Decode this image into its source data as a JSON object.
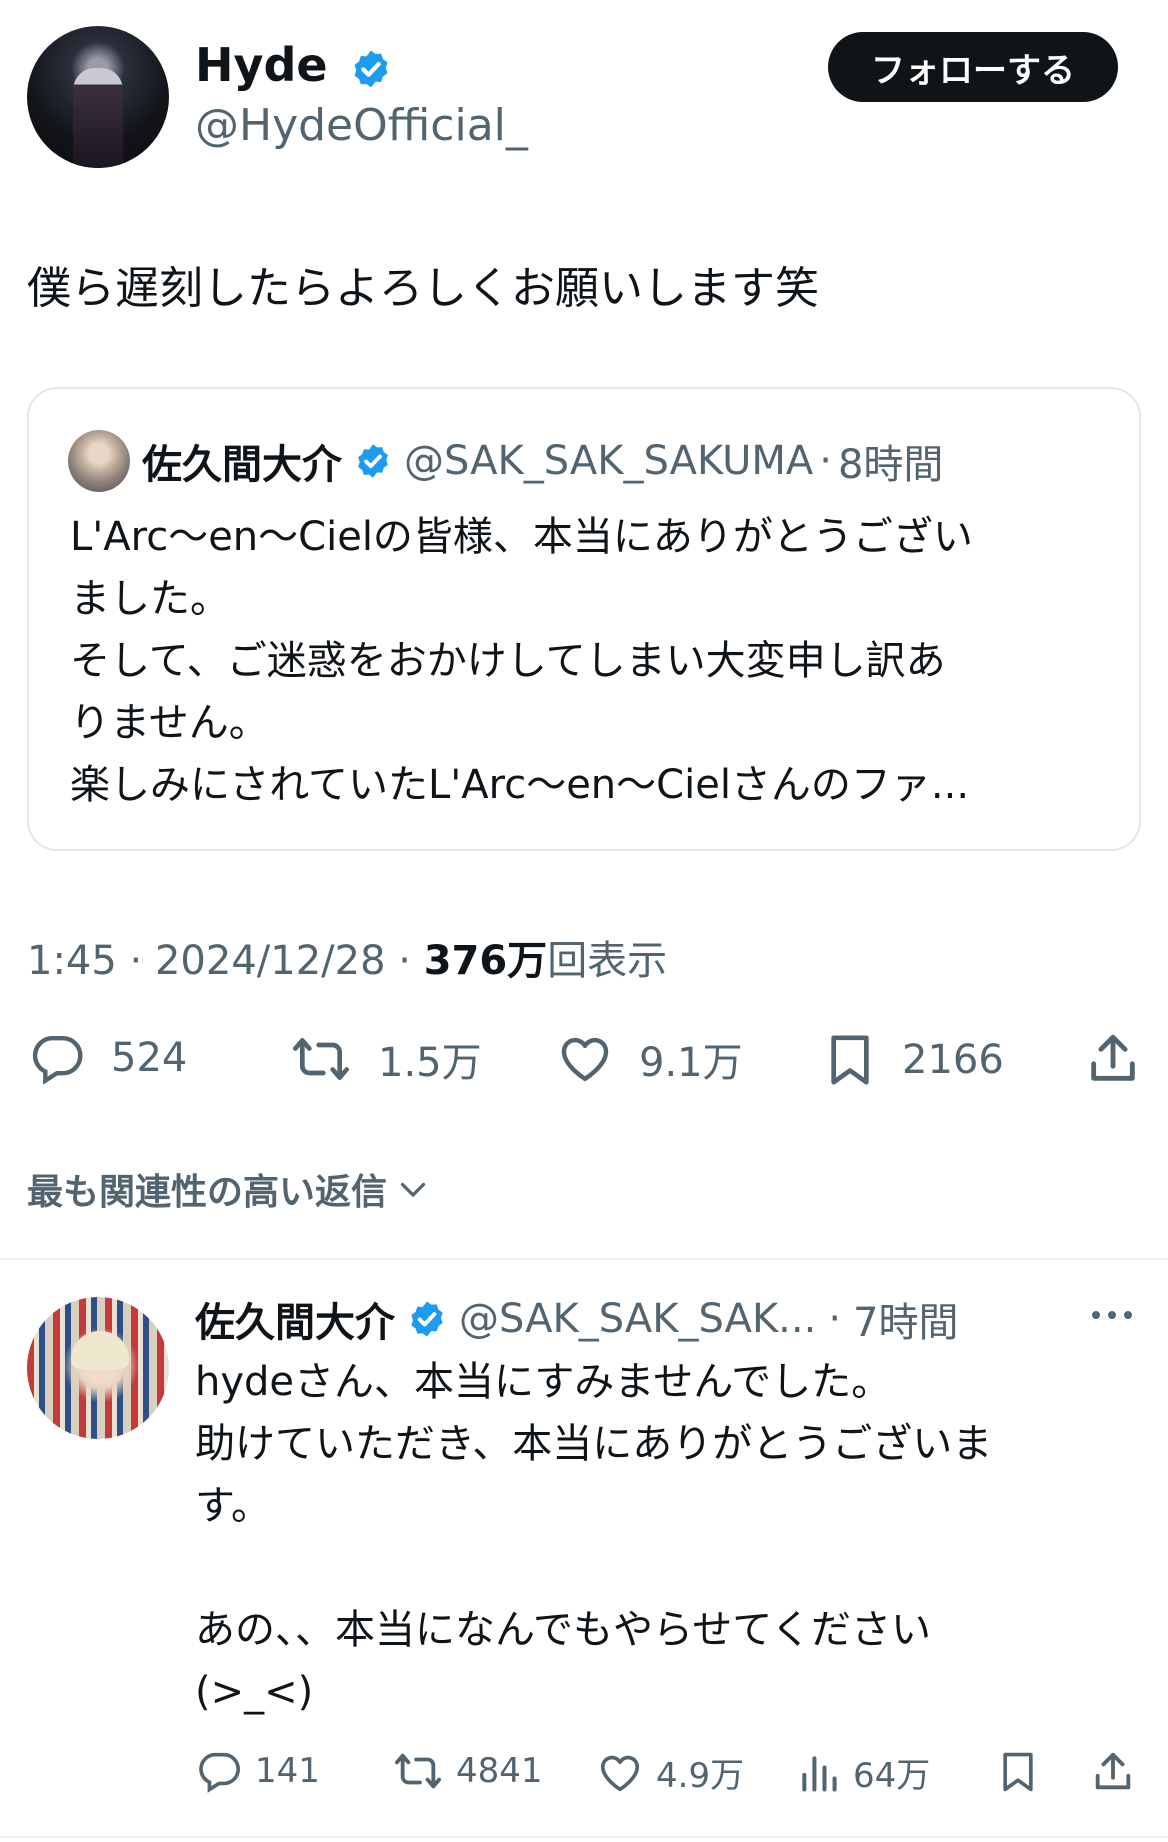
{
  "tweet": {
    "author_name": "Hyde",
    "author_handle": "@HydeOfficial_",
    "follow_label": "フォローする",
    "text": "僕ら遅刻したらよろしくお願いします笑",
    "time": "1:45",
    "date": "2024/12/28",
    "views_count": "376万",
    "views_label": "回表示",
    "stats": {
      "replies": "524",
      "retweets": "1.5万",
      "likes": "9.1万",
      "bookmarks": "2166"
    }
  },
  "quoted": {
    "author_name": "佐久間大介",
    "author_handle": "@SAK_SAK_SAKUMA",
    "time_ago": "8時間",
    "lines": [
      "L'Arc〜en〜Cielの皆様、本当にありがとうござい",
      "ました。",
      "そして、ご迷惑をおかけしてしまい大変申し訳あ",
      "りません。",
      "楽しみにされていたL'Arc〜en〜Cielさんのファ..."
    ]
  },
  "replies_sort_label": "最も関連性の高い返信",
  "reply": {
    "author_name": "佐久間大介",
    "author_handle": "@SAK_SAK_SAK...",
    "time_ago": "7時間",
    "lines": [
      "hydeさん、本当にすみませんでした。",
      "助けていただき、本当にありがとうございま",
      "す。",
      "",
      "あの、、本当になんでもやらせてください",
      "(>_<)"
    ],
    "stats": {
      "replies": "141",
      "retweets": "4841",
      "likes": "4.9万",
      "views": "64万"
    }
  },
  "colors": {
    "verified": "#1d9bf0",
    "text_primary": "#0f1419",
    "text_secondary": "#536471",
    "follow_button_bg": "#0f1419"
  }
}
